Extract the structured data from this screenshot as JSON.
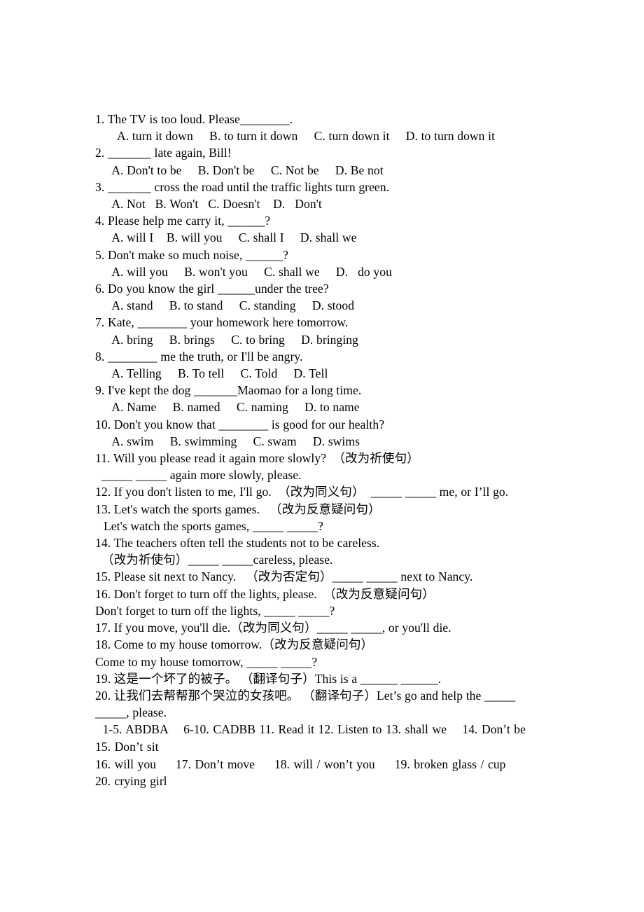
{
  "document": {
    "type": "english-grammar-worksheet",
    "background_color": "#ffffff",
    "text_color": "#000000"
  },
  "questions": [
    {
      "stem": "1. The TV is too loud. Please________.",
      "options": "   A. turn it down     B. to turn it down     C. turn down it     D. to turn down it"
    },
    {
      "stem": "2. _______ late again, Bill!",
      "options": "  A. Don't to be     B. Don't be     C. Not be     D. Be not"
    },
    {
      "stem": "3. _______ cross the road until the traffic lights turn green.",
      "options": "  A. Not   B. Won't   C. Doesn't    D.   Don't"
    },
    {
      "stem": "4. Please help me carry it, ______?",
      "options": "  A. will I    B. will you     C. shall I     D. shall we"
    },
    {
      "stem": "5. Don't make so much noise, ______?",
      "options": "  A. will you     B. won't you     C. shall we     D.   do you"
    },
    {
      "stem": "6. Do you know the girl ______under the tree?",
      "options": "  A. stand     B. to stand     C. standing     D. stood"
    },
    {
      "stem": "7. Kate, ________ your homework here tomorrow.",
      "options": "  A. bring     B. brings     C. to bring     D. bringing"
    },
    {
      "stem": "8. ________ me the truth, or I'll be angry.",
      "options": "  A. Telling     B. To tell     C. Told     D. Tell"
    },
    {
      "stem": "9. I've kept the dog _______Maomao for a long time.",
      "options": "  A. Name     B. named     C. naming     D. to name"
    },
    {
      "stem": "10. Don't you know that ________ is good for our health?",
      "options": "  A. swim     B. swimming     C. swam     D. swims"
    }
  ],
  "transform_items": [
    {
      "line": "11. Will you please read it again more slowly?  （改为祈使句）"
    },
    {
      "line": "_____ _____ again more slowly, please."
    },
    {
      "line": "12. If you don't listen to me, I'll go.  （改为同义句）  _____ _____ me, or I’ll go."
    },
    {
      "line": "13. Let's watch the sports games.   （改为反意疑问句）"
    },
    {
      "line": "Let's watch the sports games, _____ _____?"
    },
    {
      "line": "14. The teachers often tell the students not to be careless."
    },
    {
      "line": "（改为祈使句）_____ _____careless, please."
    },
    {
      "line": "15. Please sit next to Nancy.   （改为否定句）_____ _____ next to Nancy."
    },
    {
      "line": "16. Don't forget to turn off the lights, please.  （改为反意疑问句）"
    },
    {
      "line": "Don't forget to turn off the lights, _____ _____?"
    },
    {
      "line": "17. If you move, you'll die.（改为同义句）_____ _____, or you'll die."
    },
    {
      "line": "18. Come to my house tomorrow.（改为反意疑问句）"
    },
    {
      "line": "Come to my house tomorrow, _____ _____?"
    },
    {
      "line": "19. 这是一个坏了的被子。 （翻译句子）This is a ______ ______."
    },
    {
      "line": "20. 让我们去帮帮那个哭泣的女孩吧。 （翻译句子）Let’s go and help the _____"
    },
    {
      "line": "_____, please."
    }
  ],
  "answer_key": [
    " 1-5. ABDBA    6-10. CADBB 11. Read it 12. Listen to 13. shall we    14. Don’t be",
    "15. Don’t sit",
    "16. will you     17. Don’t move     18. will / won’t you     19. broken glass / cup",
    "20. crying girl"
  ]
}
